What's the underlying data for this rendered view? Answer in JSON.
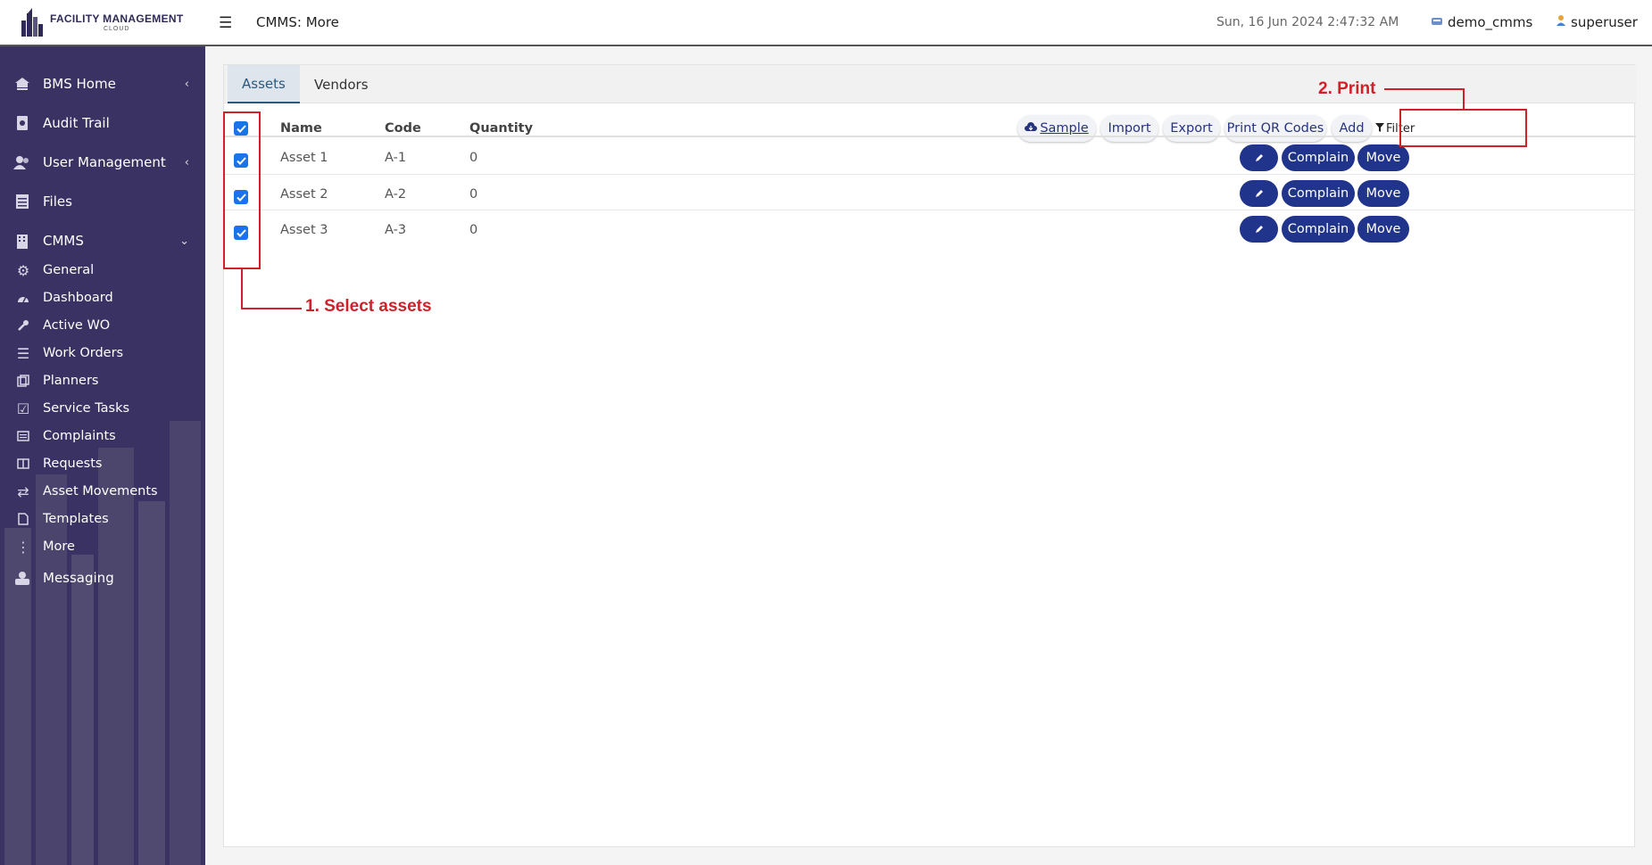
{
  "header": {
    "logo_title": "FACILITY MANAGEMENT",
    "logo_sub": "CLOUD",
    "page_title": "CMMS: More",
    "datetime": "Sun, 16 Jun 2024 2:47:32 AM",
    "db_name": "demo_cmms",
    "user_name": "superuser"
  },
  "sidebar": {
    "items": [
      {
        "label": "BMS Home",
        "icon": "home-network-icon"
      },
      {
        "label": "Audit Trail",
        "icon": "audit-icon"
      },
      {
        "label": "User Management",
        "icon": "users-icon"
      },
      {
        "label": "Files",
        "icon": "files-icon"
      },
      {
        "label": "CMMS",
        "icon": "building-icon"
      }
    ],
    "cmms_sub": [
      {
        "label": "General",
        "icon": "cogs-icon"
      },
      {
        "label": "Dashboard",
        "icon": "dashboard-icon"
      },
      {
        "label": "Active WO",
        "icon": "wrench-icon"
      },
      {
        "label": "Work Orders",
        "icon": "list-icon"
      },
      {
        "label": "Planners",
        "icon": "copy-icon"
      },
      {
        "label": "Service Tasks",
        "icon": "check-square-icon"
      },
      {
        "label": "Complaints",
        "icon": "list-alt-icon"
      },
      {
        "label": "Requests",
        "icon": "columns-icon"
      },
      {
        "label": "Asset Movements",
        "icon": "exchange-icon"
      },
      {
        "label": "Templates",
        "icon": "file-icon"
      },
      {
        "label": "More",
        "icon": "ellipsis-icon"
      }
    ],
    "messaging": {
      "label": "Messaging",
      "icon": "messaging-icon"
    }
  },
  "tabs": [
    {
      "label": "Assets",
      "active": true
    },
    {
      "label": "Vendors",
      "active": false
    }
  ],
  "table": {
    "columns": [
      "Name",
      "Code",
      "Quantity"
    ],
    "rows": [
      {
        "name": "Asset 1",
        "code": "A-1",
        "quantity": "0",
        "checked": true
      },
      {
        "name": "Asset 2",
        "code": "A-2",
        "quantity": "0",
        "checked": true
      },
      {
        "name": "Asset 3",
        "code": "A-3",
        "quantity": "0",
        "checked": true
      }
    ],
    "select_all_checked": true
  },
  "toolbar": {
    "sample": "Sample",
    "import": "Import",
    "export": "Export",
    "print_qr": "Print QR Codes",
    "add": "Add",
    "filter": "Filter"
  },
  "row_actions": {
    "complain": "Complain",
    "move": "Move"
  },
  "annotations": {
    "step1": "1. Select assets",
    "step2": "2. Print"
  },
  "colors": {
    "sidebar_bg": "#3a3262",
    "primary_button": "#21348c",
    "annotation_red": "#d0202a",
    "checkbox_blue": "#1a73e8"
  }
}
